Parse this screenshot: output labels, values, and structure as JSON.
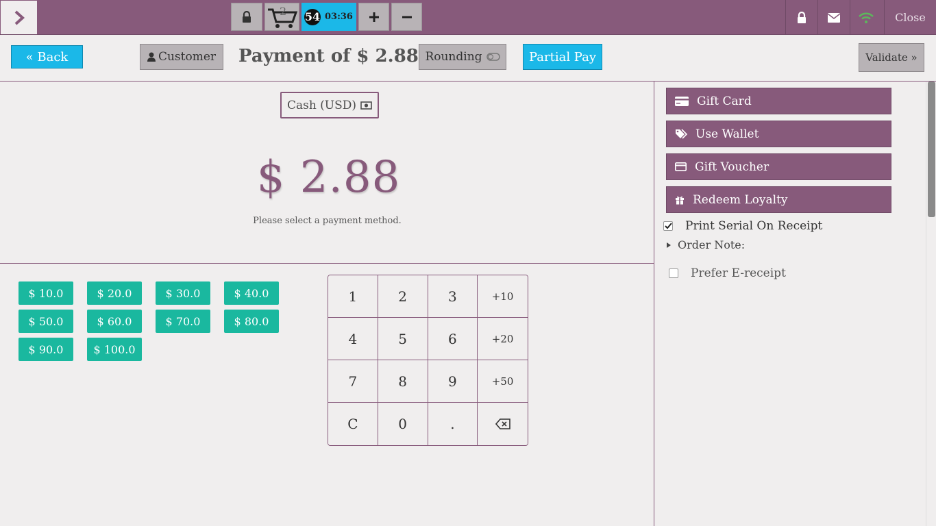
{
  "topbar": {
    "cart_count": "2",
    "order_number": "54",
    "order_time": "03:36",
    "close_label": "Close",
    "wifi_color": "#5cb85c"
  },
  "header": {
    "back_label": "« Back",
    "customer_label": "Customer",
    "title": "Payment of $ 2.88",
    "rounding_label": "Rounding",
    "partial_pay_label": "Partial Pay",
    "validate_label": "Validate »"
  },
  "payment": {
    "method_label": "Cash (USD)",
    "due_amount": "$ 2.88",
    "hint": "Please select a payment method."
  },
  "quick_amounts": [
    "$ 10.0",
    "$ 20.0",
    "$ 30.0",
    "$ 40.0",
    "$ 50.0",
    "$ 60.0",
    "$ 70.0",
    "$ 80.0",
    "$ 90.0",
    "$ 100.0"
  ],
  "numpad": {
    "keys": [
      "1",
      "2",
      "3",
      "+10",
      "4",
      "5",
      "6",
      "+20",
      "7",
      "8",
      "9",
      "+50",
      "C",
      "0",
      ".",
      "backspace"
    ]
  },
  "sidebar": {
    "buttons": [
      {
        "label": "Gift Card",
        "icon": "credit-card-icon"
      },
      {
        "label": "Use Wallet",
        "icon": "tags-icon"
      },
      {
        "label": "Gift Voucher",
        "icon": "credit-card-icon"
      },
      {
        "label": "Redeem Loyalty",
        "icon": "gift-icon"
      }
    ],
    "print_serial_label": "Print Serial On Receipt",
    "print_serial_checked": true,
    "order_note_label": "Order Note:",
    "prefer_ereceipt_label": "Prefer E-receipt",
    "prefer_ereceipt_checked": false
  },
  "colors": {
    "brand": "#875a7b",
    "accent_blue": "#1bb8e8",
    "quick_green": "#1ab89f",
    "background": "#f0eeee"
  }
}
